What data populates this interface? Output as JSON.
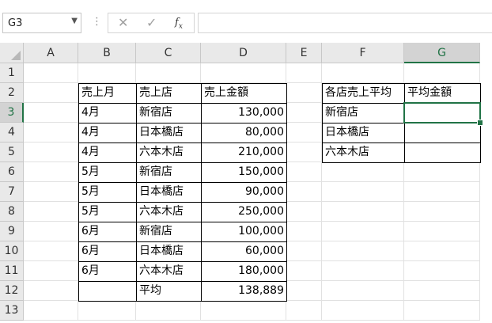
{
  "name_box": "G3",
  "formula_icons": [
    "cancel-icon",
    "enter-icon",
    "fx-icon"
  ],
  "columns": [
    "A",
    "B",
    "C",
    "D",
    "E",
    "F",
    "G"
  ],
  "rows": [
    "1",
    "2",
    "3",
    "4",
    "5",
    "6",
    "7",
    "8",
    "9",
    "10",
    "11",
    "12",
    "13"
  ],
  "active_cell": "G3",
  "accent": "#217346",
  "table1": {
    "headers": [
      "売上月",
      "売上店",
      "売上金額"
    ],
    "rows": [
      [
        "4月",
        "新宿店",
        "130,000"
      ],
      [
        "4月",
        "日本橋店",
        "80,000"
      ],
      [
        "4月",
        "六本木店",
        "210,000"
      ],
      [
        "5月",
        "新宿店",
        "150,000"
      ],
      [
        "5月",
        "日本橋店",
        "90,000"
      ],
      [
        "5月",
        "六本木店",
        "250,000"
      ],
      [
        "6月",
        "新宿店",
        "100,000"
      ],
      [
        "6月",
        "日本橋店",
        "60,000"
      ],
      [
        "6月",
        "六本木店",
        "180,000"
      ]
    ],
    "footer": [
      "",
      "平均",
      "138,889"
    ]
  },
  "table2": {
    "headers": [
      "各店売上平均",
      "平均金額"
    ],
    "rows": [
      [
        "新宿店",
        ""
      ],
      [
        "日本橋店",
        ""
      ],
      [
        "六本木店",
        ""
      ]
    ]
  }
}
